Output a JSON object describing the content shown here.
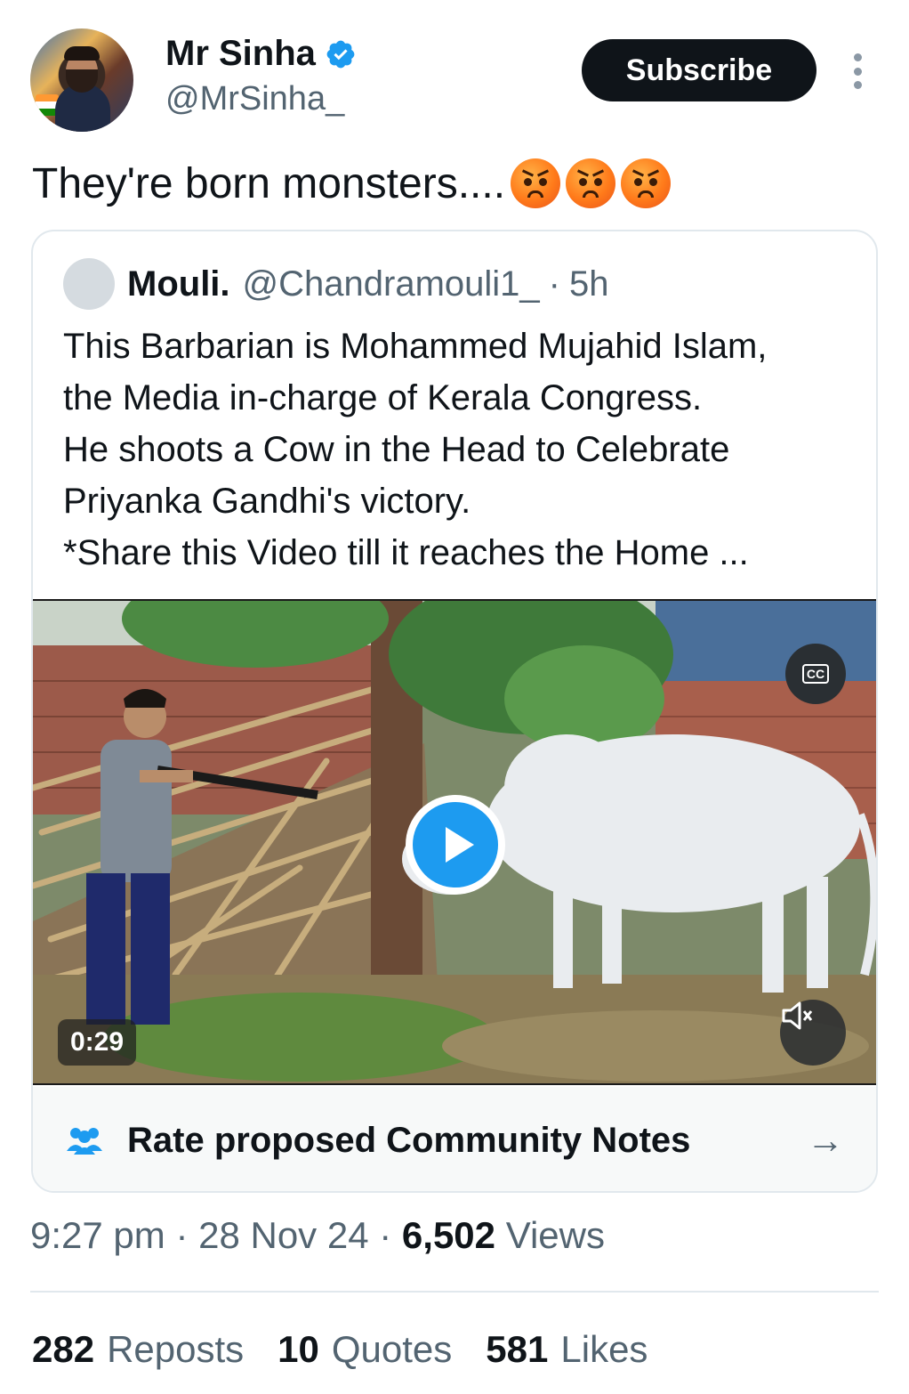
{
  "author": {
    "display_name": "Mr Sinha",
    "handle": "@MrSinha_",
    "verified_icon": "verified-badge-icon"
  },
  "actions": {
    "subscribe_label": "Subscribe",
    "more_icon": "more-vertical-icon"
  },
  "tweet": {
    "text": "They're born monsters....",
    "emojis": [
      "angry-face-icon",
      "angry-face-icon",
      "angry-face-icon"
    ]
  },
  "quoted": {
    "display_name": "Mouli.",
    "handle": "@Chandramouli1_",
    "separator": "·",
    "time": "5h",
    "lines": [
      "This Barbarian is Mohammed Mujahid Islam,",
      "the Media in-charge of Kerala Congress.",
      "He shoots a Cow in the Head to Celebrate",
      "Priyanka Gandhi's victory.",
      "*Share this Video till it reaches the Home ..."
    ],
    "video": {
      "duration": "0:29",
      "cc_label": "CC"
    }
  },
  "community_notes": {
    "label": "Rate proposed Community Notes",
    "arrow": "→"
  },
  "meta": {
    "time": "9:27 pm",
    "date": "28 Nov 24",
    "views_count": "6,502",
    "views_label": "Views",
    "sep": "·"
  },
  "stats": {
    "reposts_count": "282",
    "reposts_label": "Reposts",
    "quotes_count": "10",
    "quotes_label": "Quotes",
    "likes_count": "581",
    "likes_label": "Likes"
  },
  "colors": {
    "accent": "#1d9bf0",
    "text_primary": "#0f1419",
    "text_secondary": "#536471"
  }
}
